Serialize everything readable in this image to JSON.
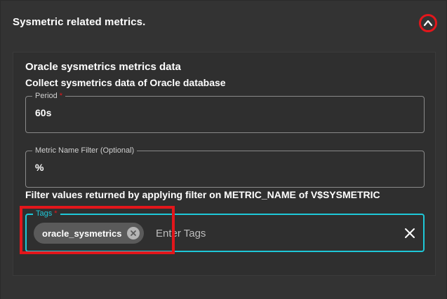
{
  "section": {
    "title": "Sysmetric related metrics.",
    "collapse_icon": "chevron-up-icon"
  },
  "card": {
    "title": "Oracle sysmetrics metrics data",
    "subtitle": "Collect sysmetrics data of Oracle database"
  },
  "fields": {
    "period": {
      "label": "Period",
      "required_mark": "*",
      "value": "60s"
    },
    "metric_name_filter": {
      "label": "Metric Name Filter (Optional)",
      "value": "%",
      "helper_text": "Filter values returned by applying filter on METRIC_NAME of V$SYSMETRIC"
    },
    "tags": {
      "label": "Tags",
      "required_mark": "*",
      "chips": [
        "oracle_sysmetrics"
      ],
      "placeholder": "Enter Tags",
      "clear_icon": "close-icon",
      "chip_delete_icon": "cancel-circle-icon"
    }
  },
  "colors": {
    "accent_focus": "#1ec8d8",
    "highlight": "#e3161b",
    "background": "#333333"
  }
}
